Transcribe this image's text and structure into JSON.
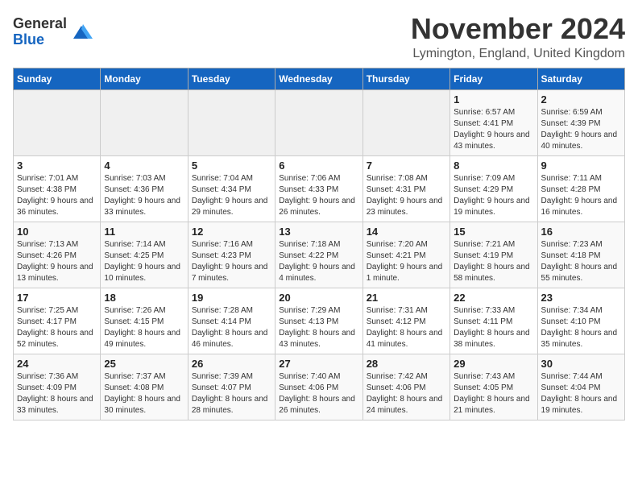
{
  "header": {
    "logo_general": "General",
    "logo_blue": "Blue",
    "month_title": "November 2024",
    "location": "Lymington, England, United Kingdom"
  },
  "days_of_week": [
    "Sunday",
    "Monday",
    "Tuesday",
    "Wednesday",
    "Thursday",
    "Friday",
    "Saturday"
  ],
  "weeks": [
    [
      {
        "day": "",
        "info": ""
      },
      {
        "day": "",
        "info": ""
      },
      {
        "day": "",
        "info": ""
      },
      {
        "day": "",
        "info": ""
      },
      {
        "day": "",
        "info": ""
      },
      {
        "day": "1",
        "info": "Sunrise: 6:57 AM\nSunset: 4:41 PM\nDaylight: 9 hours and 43 minutes."
      },
      {
        "day": "2",
        "info": "Sunrise: 6:59 AM\nSunset: 4:39 PM\nDaylight: 9 hours and 40 minutes."
      }
    ],
    [
      {
        "day": "3",
        "info": "Sunrise: 7:01 AM\nSunset: 4:38 PM\nDaylight: 9 hours and 36 minutes."
      },
      {
        "day": "4",
        "info": "Sunrise: 7:03 AM\nSunset: 4:36 PM\nDaylight: 9 hours and 33 minutes."
      },
      {
        "day": "5",
        "info": "Sunrise: 7:04 AM\nSunset: 4:34 PM\nDaylight: 9 hours and 29 minutes."
      },
      {
        "day": "6",
        "info": "Sunrise: 7:06 AM\nSunset: 4:33 PM\nDaylight: 9 hours and 26 minutes."
      },
      {
        "day": "7",
        "info": "Sunrise: 7:08 AM\nSunset: 4:31 PM\nDaylight: 9 hours and 23 minutes."
      },
      {
        "day": "8",
        "info": "Sunrise: 7:09 AM\nSunset: 4:29 PM\nDaylight: 9 hours and 19 minutes."
      },
      {
        "day": "9",
        "info": "Sunrise: 7:11 AM\nSunset: 4:28 PM\nDaylight: 9 hours and 16 minutes."
      }
    ],
    [
      {
        "day": "10",
        "info": "Sunrise: 7:13 AM\nSunset: 4:26 PM\nDaylight: 9 hours and 13 minutes."
      },
      {
        "day": "11",
        "info": "Sunrise: 7:14 AM\nSunset: 4:25 PM\nDaylight: 9 hours and 10 minutes."
      },
      {
        "day": "12",
        "info": "Sunrise: 7:16 AM\nSunset: 4:23 PM\nDaylight: 9 hours and 7 minutes."
      },
      {
        "day": "13",
        "info": "Sunrise: 7:18 AM\nSunset: 4:22 PM\nDaylight: 9 hours and 4 minutes."
      },
      {
        "day": "14",
        "info": "Sunrise: 7:20 AM\nSunset: 4:21 PM\nDaylight: 9 hours and 1 minute."
      },
      {
        "day": "15",
        "info": "Sunrise: 7:21 AM\nSunset: 4:19 PM\nDaylight: 8 hours and 58 minutes."
      },
      {
        "day": "16",
        "info": "Sunrise: 7:23 AM\nSunset: 4:18 PM\nDaylight: 8 hours and 55 minutes."
      }
    ],
    [
      {
        "day": "17",
        "info": "Sunrise: 7:25 AM\nSunset: 4:17 PM\nDaylight: 8 hours and 52 minutes."
      },
      {
        "day": "18",
        "info": "Sunrise: 7:26 AM\nSunset: 4:15 PM\nDaylight: 8 hours and 49 minutes."
      },
      {
        "day": "19",
        "info": "Sunrise: 7:28 AM\nSunset: 4:14 PM\nDaylight: 8 hours and 46 minutes."
      },
      {
        "day": "20",
        "info": "Sunrise: 7:29 AM\nSunset: 4:13 PM\nDaylight: 8 hours and 43 minutes."
      },
      {
        "day": "21",
        "info": "Sunrise: 7:31 AM\nSunset: 4:12 PM\nDaylight: 8 hours and 41 minutes."
      },
      {
        "day": "22",
        "info": "Sunrise: 7:33 AM\nSunset: 4:11 PM\nDaylight: 8 hours and 38 minutes."
      },
      {
        "day": "23",
        "info": "Sunrise: 7:34 AM\nSunset: 4:10 PM\nDaylight: 8 hours and 35 minutes."
      }
    ],
    [
      {
        "day": "24",
        "info": "Sunrise: 7:36 AM\nSunset: 4:09 PM\nDaylight: 8 hours and 33 minutes."
      },
      {
        "day": "25",
        "info": "Sunrise: 7:37 AM\nSunset: 4:08 PM\nDaylight: 8 hours and 30 minutes."
      },
      {
        "day": "26",
        "info": "Sunrise: 7:39 AM\nSunset: 4:07 PM\nDaylight: 8 hours and 28 minutes."
      },
      {
        "day": "27",
        "info": "Sunrise: 7:40 AM\nSunset: 4:06 PM\nDaylight: 8 hours and 26 minutes."
      },
      {
        "day": "28",
        "info": "Sunrise: 7:42 AM\nSunset: 4:06 PM\nDaylight: 8 hours and 24 minutes."
      },
      {
        "day": "29",
        "info": "Sunrise: 7:43 AM\nSunset: 4:05 PM\nDaylight: 8 hours and 21 minutes."
      },
      {
        "day": "30",
        "info": "Sunrise: 7:44 AM\nSunset: 4:04 PM\nDaylight: 8 hours and 19 minutes."
      }
    ]
  ]
}
